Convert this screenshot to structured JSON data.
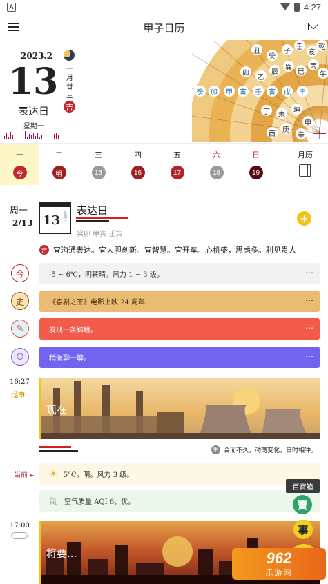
{
  "status_bar": {
    "time": "4:27",
    "app_icon_letter": "A"
  },
  "app_bar": {
    "title": "甲子日历"
  },
  "hero": {
    "year_month": "2023.2",
    "day": "13",
    "day_name": "表达日",
    "weekday": "星期一",
    "lunar_vertical": "一月廿三",
    "ji_badge": "吉",
    "compass_outer": [
      "丑",
      "癸",
      "子",
      "壬",
      "亥",
      "乾"
    ],
    "compass_middle": [
      "卯",
      "乙",
      "辰",
      "巽",
      "巳",
      "丙",
      "午"
    ],
    "compass_row": [
      "癸",
      "卯",
      "甲",
      "寅",
      "壬",
      "寅",
      "戊",
      "申"
    ],
    "compass_lower": [
      "丁",
      "未",
      "坤",
      "申",
      "庚",
      "酉",
      "辛"
    ]
  },
  "week": {
    "days": [
      {
        "label": "一",
        "glyph": "今",
        "color": "#c0282e",
        "red": false,
        "active": true
      },
      {
        "label": "二",
        "glyph": "明",
        "color": "#a01d22",
        "red": false,
        "active": false
      },
      {
        "label": "三",
        "glyph": "15",
        "color": "#9a9a9a",
        "red": false,
        "active": false
      },
      {
        "label": "四",
        "glyph": "16",
        "color": "#a01d22",
        "red": false,
        "active": false
      },
      {
        "label": "五",
        "glyph": "17",
        "color": "#b3232a",
        "red": false,
        "active": false
      },
      {
        "label": "六",
        "glyph": "18",
        "color": "#9a9a9a",
        "red": true,
        "active": false
      },
      {
        "label": "日",
        "glyph": "19",
        "color": "#5a0a0e",
        "red": true,
        "active": false
      }
    ],
    "calendar_label": "月历"
  },
  "today": {
    "weekday": "周一",
    "date": "2/13",
    "mini_day": "13",
    "mini_side": "星期一",
    "name": "表达日",
    "ganzhi": "癸卯 甲寅 壬寅",
    "add_label": "+",
    "ji_badge": "吉",
    "ji_text": "宜沟通表达。宜大胆创新。宜智慧。宜开车。心机盛，思虑多。利见贵人"
  },
  "feed": [
    {
      "icon": "今",
      "icon_bg": "#fff",
      "icon_color": "#c0282e",
      "text": "-5 ~ 6℃，阴转晴。风力 1 ~ 3 级。",
      "bg": "#f2f2f2",
      "fg": "#333"
    },
    {
      "icon": "史",
      "icon_bg": "#f7e3b5",
      "icon_color": "#8a5a10",
      "text": "《喜剧之王》电影上映 24 周年",
      "bg": "#ecbb73",
      "fg": "#3a2a10"
    },
    {
      "icon": "✎",
      "icon_bg": "#e2f2fb",
      "icon_color": "#e0502c",
      "text": "发现一条锦鲤。",
      "bg": "#f25a4a",
      "fg": "#fff"
    },
    {
      "icon": "☺",
      "icon_bg": "#efe8fb",
      "icon_color": "#7a5ac8",
      "text": "稍微聊一聊。",
      "bg": "#7263f0",
      "fg": "#fff"
    }
  ],
  "scene_now": {
    "time": "16:27",
    "ganzhi": "戊申",
    "caption": "现在",
    "quote_badge": "甲",
    "quote": "合而不久，动荡变化，日时相冲。"
  },
  "current": {
    "label": "当前",
    "weather": "5°C。晴。风力 3 级。",
    "aqi_icon": "氣",
    "aqi": "空气质量 AQI 6，优。"
  },
  "scene_next": {
    "time": "17:00",
    "caption": "将要..."
  },
  "floating": {
    "badge": "百寶箱",
    "fab_treasure": "寶",
    "fab_event": "事"
  },
  "watermark": {
    "big": "962",
    "small": "乐游网"
  }
}
